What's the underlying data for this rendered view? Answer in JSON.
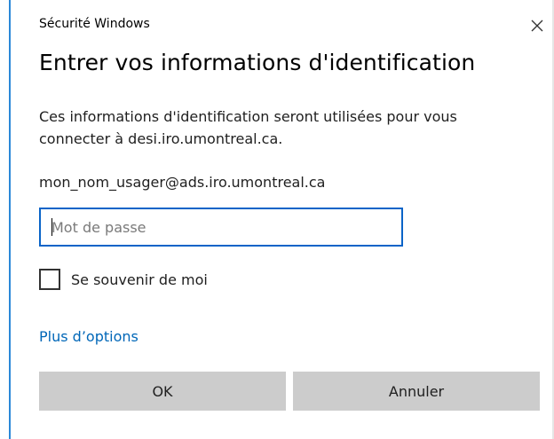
{
  "window": {
    "title": "Sécurité Windows",
    "accent_color": "#2b88d8"
  },
  "dialog": {
    "heading": "Entrer vos informations d'identification",
    "description": "Ces informations d'identification seront utilisées pour vous connecter à desi.iro.umontreal.ca.",
    "username": "mon_nom_usager@ads.iro.umontreal.ca",
    "password": {
      "value": "",
      "placeholder": "Mot de passe"
    },
    "remember_me": {
      "label": "Se souvenir de moi",
      "checked": false
    },
    "more_options_label": "Plus d’options",
    "link_color": "#0067b8"
  },
  "buttons": {
    "ok_label": "OK",
    "cancel_label": "Annuler"
  },
  "icons": {
    "close": "close-icon"
  }
}
